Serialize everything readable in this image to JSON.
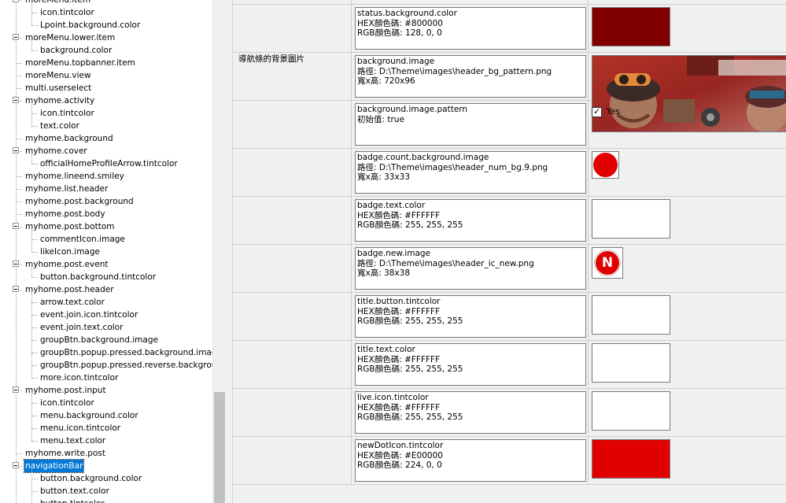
{
  "tree": {
    "nodes": [
      {
        "label": "moreMenu.item",
        "level": 1,
        "expander": true
      },
      {
        "label": "icon.tintcolor",
        "level": 2
      },
      {
        "label": "Lpoint.background.color",
        "level": 2
      },
      {
        "label": "moreMenu.lower.item",
        "level": 1,
        "expander": true
      },
      {
        "label": "background.color",
        "level": 2
      },
      {
        "label": "moreMenu.topbanner.item",
        "level": 1
      },
      {
        "label": "moreMenu.view",
        "level": 1
      },
      {
        "label": "multi.userselect",
        "level": 1
      },
      {
        "label": "myhome.activity",
        "level": 1,
        "expander": true
      },
      {
        "label": "icon.tintcolor",
        "level": 2
      },
      {
        "label": "text.color",
        "level": 2
      },
      {
        "label": "myhome.background",
        "level": 1
      },
      {
        "label": "myhome.cover",
        "level": 1,
        "expander": true
      },
      {
        "label": "officialHomeProfileArrow.tintcolor",
        "level": 2
      },
      {
        "label": "myhome.lineend.smiley",
        "level": 1
      },
      {
        "label": "myhome.list.header",
        "level": 1
      },
      {
        "label": "myhome.post.background",
        "level": 1
      },
      {
        "label": "myhome.post.body",
        "level": 1
      },
      {
        "label": "myhome.post.bottom",
        "level": 1,
        "expander": true
      },
      {
        "label": "commentIcon.image",
        "level": 2
      },
      {
        "label": "likeIcon.image",
        "level": 2
      },
      {
        "label": "myhome.post.event",
        "level": 1,
        "expander": true
      },
      {
        "label": "button.background.tintcolor",
        "level": 2
      },
      {
        "label": "myhome.post.header",
        "level": 1,
        "expander": true
      },
      {
        "label": "arrow.text.color",
        "level": 2
      },
      {
        "label": "event.join.icon.tintcolor",
        "level": 2
      },
      {
        "label": "event.join.text.color",
        "level": 2
      },
      {
        "label": "groupBtn.background.image",
        "level": 2
      },
      {
        "label": "groupBtn.popup.pressed.background.image",
        "level": 2
      },
      {
        "label": "groupBtn.popup.pressed.reverse.background.i",
        "level": 2
      },
      {
        "label": "more.icon.tintcolor",
        "level": 2
      },
      {
        "label": "myhome.post.input",
        "level": 1,
        "expander": true
      },
      {
        "label": "icon.tintcolor",
        "level": 2
      },
      {
        "label": "menu.background.color",
        "level": 2
      },
      {
        "label": "menu.icon.tintcolor",
        "level": 2
      },
      {
        "label": "menu.text.color",
        "level": 2
      },
      {
        "label": "myhome.write.post",
        "level": 1
      },
      {
        "label": "navigationBar",
        "level": 1,
        "expander": true,
        "selected": true
      },
      {
        "label": "button.background.color",
        "level": 2
      },
      {
        "label": "button.text.color",
        "level": 2
      },
      {
        "label": "button.tintcolor",
        "level": 2
      }
    ]
  },
  "grid": {
    "rows": [
      {
        "label": "",
        "lines": [
          "status.background.color",
          "HEX顏色碼: #800000",
          "RGB顏色碼: 128, 0, 0"
        ],
        "preview": {
          "kind": "color",
          "color": "#800000"
        }
      },
      {
        "label": "導航條的背景圖片",
        "lines": [
          "background.image",
          "路徑: D:\\Theme\\images\\header_bg_pattern.png",
          "寬x高: 720x96"
        ],
        "preview": {
          "kind": "image"
        }
      },
      {
        "label": "",
        "lines": [
          "background.image.pattern",
          "初始值: true"
        ],
        "preview": {
          "kind": "check",
          "check_label": "Yes",
          "checked": true
        }
      },
      {
        "label": "",
        "lines": [
          "badge.count.background.image",
          "路徑: D:\\Theme\\images\\header_num_bg.9.png",
          "寬x高: 33x33"
        ],
        "preview": {
          "kind": "dot",
          "color": "#e00000"
        }
      },
      {
        "label": "",
        "lines": [
          "badge.text.color",
          "HEX顏色碼: #FFFFFF",
          "RGB顏色碼: 255, 255, 255"
        ],
        "preview": {
          "kind": "color",
          "color": "#ffffff"
        }
      },
      {
        "label": "",
        "lines": [
          "badge.new.image",
          "路徑: D:\\Theme\\images\\header_ic_new.png",
          "寬x高: 38x38"
        ],
        "preview": {
          "kind": "newbadge",
          "color": "#e00000",
          "text": "N"
        }
      },
      {
        "label": "",
        "lines": [
          "title.button.tintcolor",
          "HEX顏色碼: #FFFFFF",
          "RGB顏色碼: 255, 255, 255"
        ],
        "preview": {
          "kind": "color",
          "color": "#ffffff"
        }
      },
      {
        "label": "",
        "lines": [
          "title.text.color",
          "HEX顏色碼: #FFFFFF",
          "RGB顏色碼: 255, 255, 255"
        ],
        "preview": {
          "kind": "color",
          "color": "#ffffff"
        }
      },
      {
        "label": "",
        "lines": [
          "live.icon.tintcolor",
          "HEX顏色碼: #FFFFFF",
          "RGB顏色碼: 255, 255, 255"
        ],
        "preview": {
          "kind": "color",
          "color": "#ffffff"
        }
      },
      {
        "label": "",
        "lines": [
          "newDotIcon.tintcolor",
          "HEX顏色碼: #E00000",
          "RGB顏色碼: 224, 0, 0"
        ],
        "preview": {
          "kind": "color",
          "color": "#e00000"
        }
      }
    ]
  }
}
